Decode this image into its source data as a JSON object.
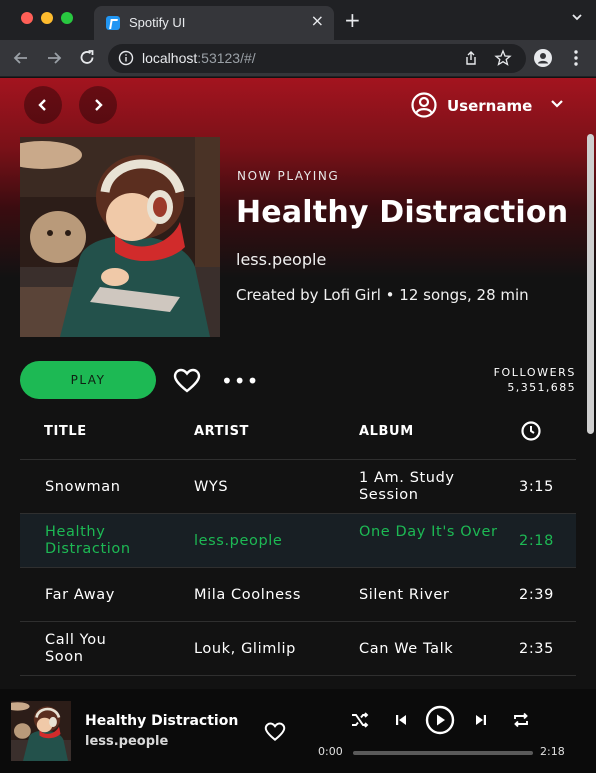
{
  "browser": {
    "tab_title": "Spotify UI",
    "tab_close": "×",
    "new_tab": "+",
    "url_host": "localhost",
    "url_rest": ":53123/#/"
  },
  "topbar": {
    "username": "Username"
  },
  "playlist": {
    "label": "NOW PLAYING",
    "title": "Healthy Distraction",
    "artist": "less.people",
    "meta": "Created by Lofi Girl • 12 songs, 28 min",
    "play_label": "PLAY",
    "more_label": "•••",
    "followers_label": "FOLLOWERS",
    "followers_count": "5,351,685"
  },
  "table": {
    "columns": {
      "title": "TITLE",
      "artist": "ARTIST",
      "album": "ALBUM"
    },
    "rows": [
      {
        "title": "Snowman",
        "artist": "WYS",
        "album": "1 Am. Study Session",
        "time": "3:15"
      },
      {
        "title": "Healthy Distraction",
        "artist": "less.people",
        "album": "One Day It's Over",
        "time": "2:18"
      },
      {
        "title": "Far Away",
        "artist": "Mila Coolness",
        "album": "Silent River",
        "time": "2:39"
      },
      {
        "title": "Call You Soon",
        "artist": "Louk, Glimlip",
        "album": "Can We Talk",
        "time": "2:35"
      }
    ]
  },
  "player": {
    "title": "Healthy Distraction",
    "artist": "less.people",
    "elapsed": "0:00",
    "duration": "2:18",
    "progress": 0
  },
  "colors": {
    "accent": "#1db954",
    "header_red": "#a3141f",
    "background": "#121212"
  }
}
